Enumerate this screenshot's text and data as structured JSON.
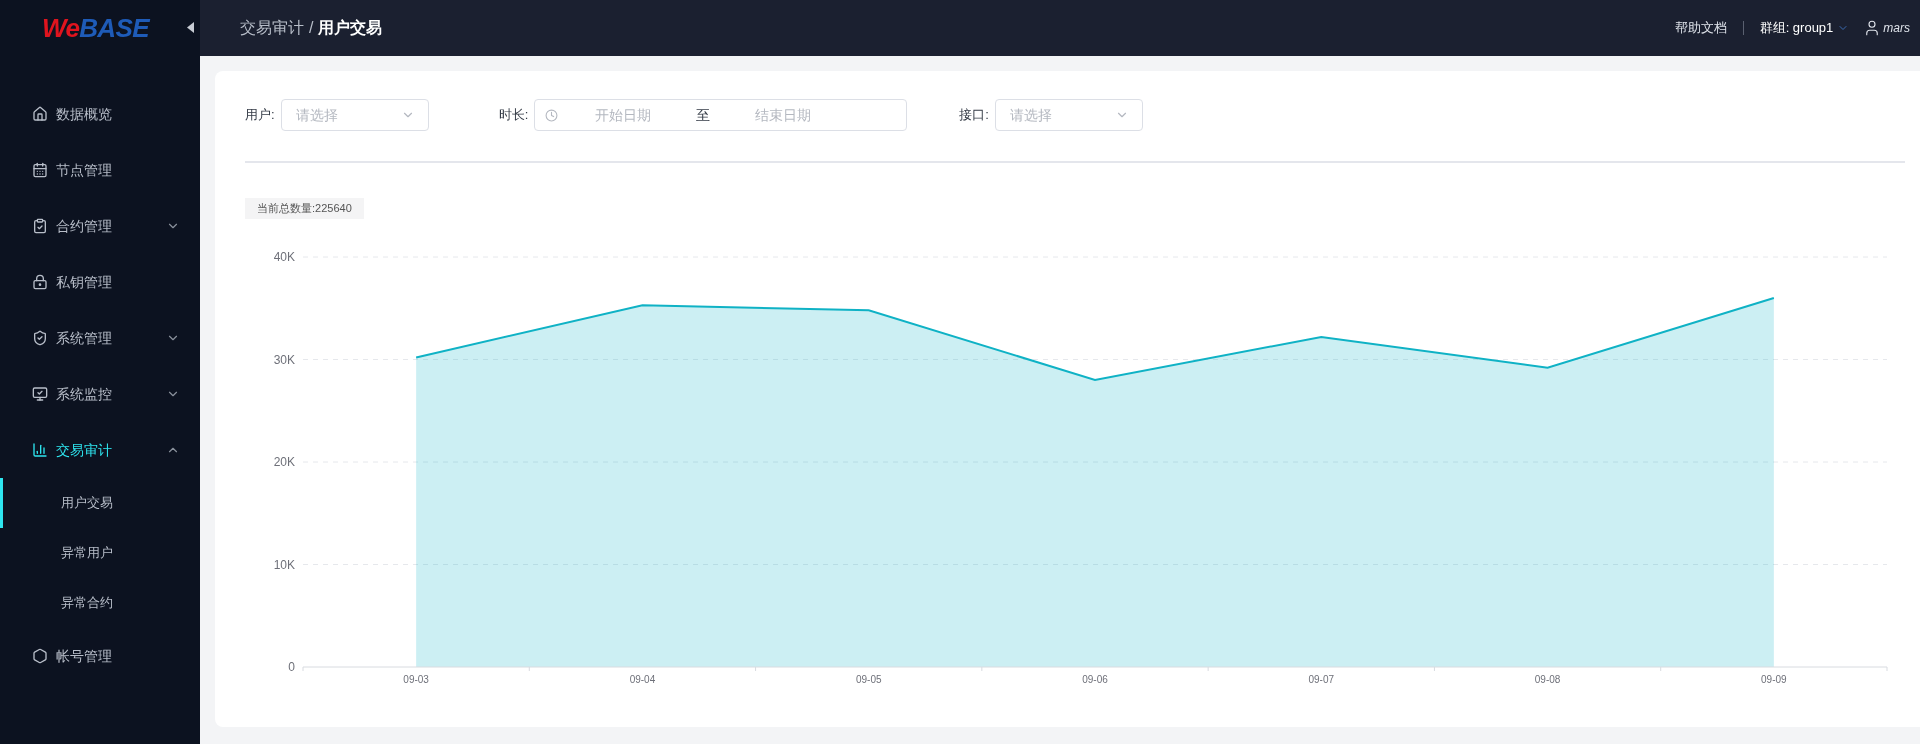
{
  "logo": {
    "part1": "We",
    "part2": "BASE"
  },
  "sidebar": {
    "items": [
      {
        "label": "数据概览",
        "has_chevron": false,
        "selected": false
      },
      {
        "label": "节点管理",
        "has_chevron": false,
        "selected": false
      },
      {
        "label": "合约管理",
        "has_chevron": true,
        "expanded": false,
        "selected": false
      },
      {
        "label": "私钥管理",
        "has_chevron": false,
        "selected": false
      },
      {
        "label": "系统管理",
        "has_chevron": true,
        "expanded": false,
        "selected": false
      },
      {
        "label": "系统监控",
        "has_chevron": true,
        "expanded": false,
        "selected": false
      },
      {
        "label": "交易审计",
        "has_chevron": true,
        "expanded": true,
        "selected": true,
        "children": [
          {
            "label": "用户交易",
            "selected": true
          },
          {
            "label": "异常用户",
            "selected": false
          },
          {
            "label": "异常合约",
            "selected": false
          }
        ]
      },
      {
        "label": "帐号管理",
        "has_chevron": false,
        "selected": false
      }
    ]
  },
  "header": {
    "breadcrumb": [
      "交易审计",
      "/",
      "用户交易"
    ],
    "help": "帮助文档",
    "group": "群组: group1",
    "user": "mars"
  },
  "filters": {
    "user": {
      "label": "用户:",
      "placeholder": "请选择"
    },
    "duration": {
      "label": "时长:",
      "start_placeholder": "开始日期",
      "separator": "至",
      "end_placeholder": "结束日期"
    },
    "api": {
      "label": "接口:",
      "placeholder": "请选择"
    }
  },
  "total": "当前总数量:225640",
  "chart_data": {
    "type": "area",
    "categories": [
      "09-03",
      "09-04",
      "09-05",
      "09-06",
      "09-07",
      "09-08",
      "09-09"
    ],
    "series": [
      {
        "color": "#0fb2c5",
        "values": [
          30200,
          35300,
          34800,
          28000,
          32200,
          29200,
          36000
        ]
      }
    ],
    "grid": true,
    "ylim": [
      0,
      40000
    ],
    "yticks": [
      {
        "value": 0,
        "label": "0"
      },
      {
        "value": 10000,
        "label": "10K"
      },
      {
        "value": 20000,
        "label": "20K"
      },
      {
        "value": 30000,
        "label": "30K"
      },
      {
        "value": 40000,
        "label": "40K"
      }
    ]
  }
}
